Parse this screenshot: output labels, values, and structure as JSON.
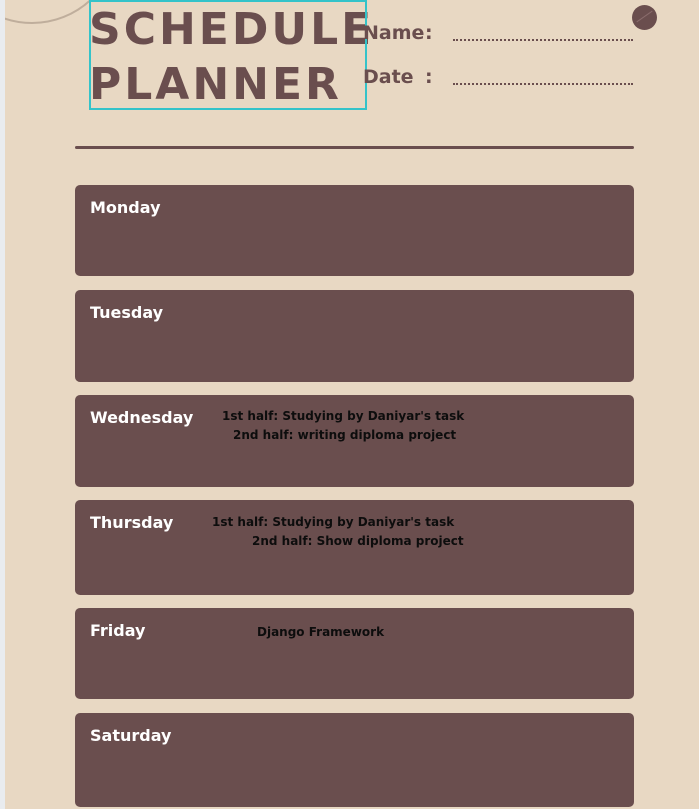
{
  "header": {
    "title_line1": "SCHEDULE",
    "title_line2": "PLANNER",
    "name_label": "Name",
    "date_label": "Date",
    "colon": ":"
  },
  "days": [
    {
      "name": "Monday",
      "tasks": []
    },
    {
      "name": "Tuesday",
      "tasks": []
    },
    {
      "name": "Wednesday",
      "tasks": [
        "1st half: Studying by Daniyar's task",
        "2nd half: writing diploma project"
      ]
    },
    {
      "name": "Thursday",
      "tasks": [
        "1st half: Studying by Daniyar's task",
        "2nd half: Show diploma project"
      ]
    },
    {
      "name": "Friday",
      "tasks": [
        "Django Framework"
      ]
    },
    {
      "name": "Saturday",
      "tasks": []
    }
  ],
  "colors": {
    "page_background": "#e8d8c3",
    "accent_brown": "#6a4e4e",
    "selection_border": "#34c3c9"
  }
}
